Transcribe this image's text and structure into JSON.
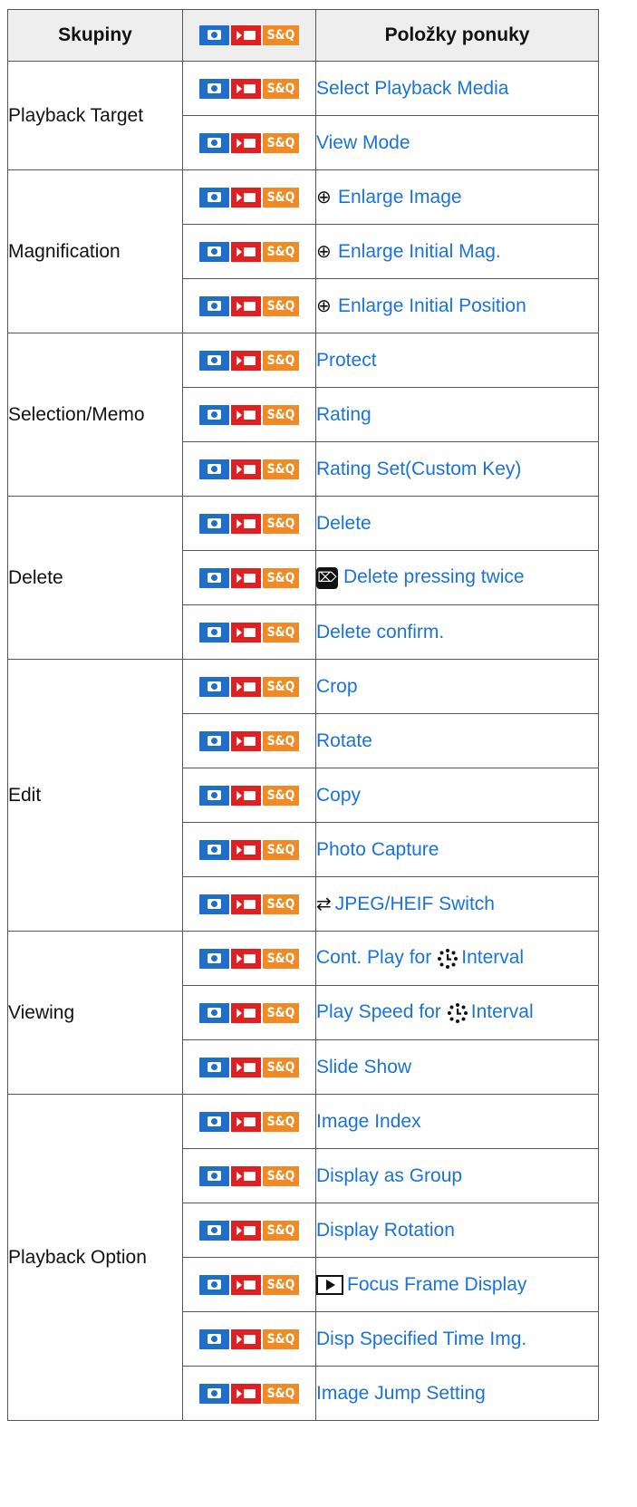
{
  "header": {
    "groups": "Skupiny",
    "sq_label": "S&Q",
    "items": "Položky ponuky"
  },
  "icons": {
    "photo": "camera-icon",
    "movie": "movie-icon",
    "sq": "S&Q",
    "colors": {
      "photo": "#1f6ec8",
      "movie": "#e02020",
      "sq": "#f08a24",
      "link": "#1a73d9"
    }
  },
  "groups": [
    {
      "name": "Playback Target",
      "items": [
        {
          "label": "Select Playback Media"
        },
        {
          "label": "View Mode"
        }
      ]
    },
    {
      "name": "Magnification",
      "items": [
        {
          "label": "Enlarge Image",
          "prefix": "magnifier-icon"
        },
        {
          "label": "Enlarge Initial Mag.",
          "prefix": "magnifier-icon"
        },
        {
          "label": "Enlarge Initial Position",
          "prefix": "magnifier-icon"
        }
      ]
    },
    {
      "name": "Selection/Memo",
      "items": [
        {
          "label": "Protect"
        },
        {
          "label": "Rating"
        },
        {
          "label": "Rating Set(Custom Key)"
        }
      ]
    },
    {
      "name": "Delete",
      "items": [
        {
          "label": "Delete"
        },
        {
          "label": "Delete pressing twice",
          "prefix": "trash-icon"
        },
        {
          "label": "Delete confirm."
        }
      ]
    },
    {
      "name": "Edit",
      "items": [
        {
          "label": "Crop"
        },
        {
          "label": "Rotate"
        },
        {
          "label": "Copy"
        },
        {
          "label": "Photo Capture"
        },
        {
          "label": "JPEG/HEIF Switch",
          "prefix": "format-switch-icon"
        }
      ]
    },
    {
      "name": "Viewing",
      "items": [
        {
          "label_a": "Cont. Play for",
          "label_b": "Interval",
          "mid": "interval-icon"
        },
        {
          "label_a": "Play Speed for",
          "label_b": "Interval",
          "mid": "interval-icon"
        },
        {
          "label": "Slide Show"
        }
      ]
    },
    {
      "name": "Playback Option",
      "items": [
        {
          "label": "Image Index"
        },
        {
          "label": "Display as Group"
        },
        {
          "label": "Display Rotation"
        },
        {
          "label": "Focus Frame Display",
          "prefix": "play-icon"
        },
        {
          "label": "Disp Specified Time Img."
        },
        {
          "label": "Image Jump Setting"
        }
      ]
    }
  ]
}
